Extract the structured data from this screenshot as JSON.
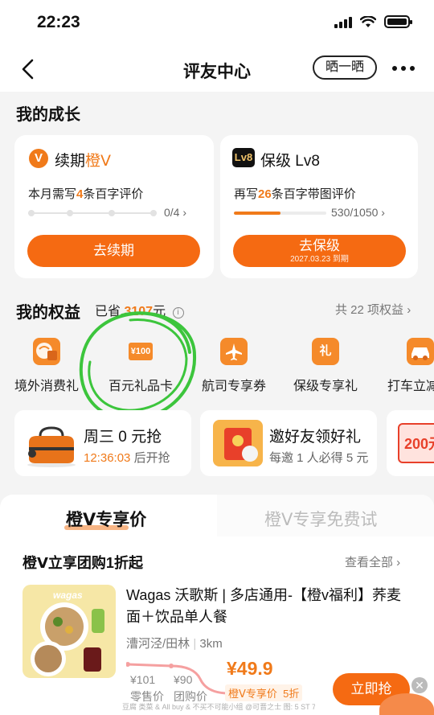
{
  "status_bar": {
    "time": "22:23"
  },
  "nav": {
    "title": "评友中心",
    "share_label": "晒一晒"
  },
  "growth": {
    "title": "我的成长",
    "renew_card": {
      "badge": "V",
      "title_prefix": "续期",
      "title_accent": "橙Ⅴ",
      "desc_prefix": "本月需写",
      "desc_num": "4",
      "desc_suffix": "条百字评价",
      "progress_text": "0/4",
      "progress_fraction": 0,
      "button_label": "去续期"
    },
    "level_card": {
      "badge": "Lv8",
      "title": "保级 Lv8",
      "desc_prefix": "再写",
      "desc_num": "26",
      "desc_suffix": "条百字带图评价",
      "progress_text": "530/1050",
      "progress_fraction": 0.505,
      "button_label": "去保级",
      "button_sub": "2027.03.23 到期"
    }
  },
  "benefits": {
    "title": "我的权益",
    "saved_prefix": "已省",
    "saved_amount": "3107",
    "saved_suffix": "元",
    "total_label": "共 22 项权益",
    "items": [
      {
        "label": "境外消费礼",
        "icon": "bag-globe-icon"
      },
      {
        "label": "百元礼品卡",
        "icon": "gift-card-icon",
        "icon_text": "¥100"
      },
      {
        "label": "航司专享券",
        "icon": "plane-ticket-icon"
      },
      {
        "label": "保级专享礼",
        "icon": "gift-box-icon",
        "icon_text": "礼"
      },
      {
        "label": "打车立减",
        "icon": "car-icon"
      }
    ]
  },
  "promos": [
    {
      "title": "周三 0 元抢",
      "countdown": "12:36:03",
      "countdown_suffix": "后开抢"
    },
    {
      "title": "邀好友领好礼",
      "sub": "每邀 1 人必得 5 元"
    },
    {
      "title": "200元"
    }
  ],
  "tabs": {
    "active": "橙Ⅴ专享价",
    "inactive": "橙Ⅴ专享免费试"
  },
  "group_buy": {
    "title": "橙Ⅴ立享团购1折起",
    "view_all": "查看全部",
    "product": {
      "img_label": "wagas",
      "name": "Wagas 沃歌斯 | 多店通用-【橙v福利】荞麦面＋饮品单人餐",
      "location": "漕河泾/田林",
      "distance": "3km",
      "sale_price_label": "¥101",
      "sale_caption": "零售价",
      "group_price_label": "¥90",
      "group_caption": "团购价",
      "v_price": "¥49.9",
      "v_caption": "橙Ⅴ专享价",
      "discount": "5折",
      "buy_label": "立即抢"
    },
    "footer_note": "豆腐 类菜 & All buy & 不买不可能小组 @可晋之士 图: 5 ST 7 483"
  },
  "colors": {
    "accent": "#f07a1a",
    "button": "#f56a12",
    "annotation": "#3cc53c"
  }
}
